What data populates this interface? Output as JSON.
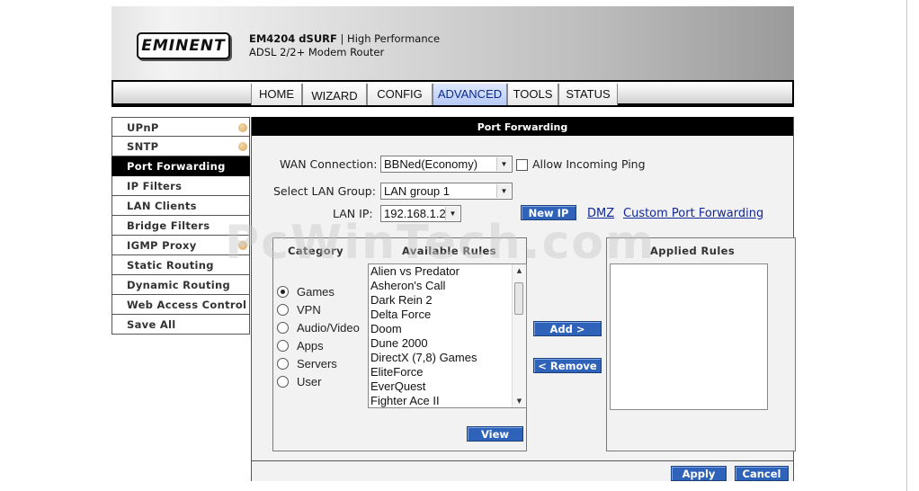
{
  "header": {
    "logo_text": "EMINENT",
    "model": "EM4204 dSURF",
    "tagline": "| High Performance",
    "subtitle": "ADSL 2/2+ Modem Router"
  },
  "tabs": [
    {
      "label": "HOME"
    },
    {
      "label": "WIZARD"
    },
    {
      "label": "CONFIG"
    },
    {
      "label": "ADVANCED",
      "active": true
    },
    {
      "label": "TOOLS"
    },
    {
      "label": "STATUS"
    }
  ],
  "sidebar": {
    "items": [
      {
        "label": "UPnP"
      },
      {
        "label": "SNTP"
      },
      {
        "label": "Port Forwarding"
      },
      {
        "label": "IP Filters"
      },
      {
        "label": "LAN Clients"
      },
      {
        "label": "Bridge Filters"
      },
      {
        "label": "IGMP Proxy"
      },
      {
        "label": "Static Routing"
      },
      {
        "label": "Dynamic Routing"
      },
      {
        "label": "Web Access Control"
      },
      {
        "label": "Save All"
      }
    ]
  },
  "main": {
    "title": "Port Forwarding",
    "wan_label": "WAN Connection:",
    "wan_value": "BBNed(Economy)",
    "ping_label": "Allow Incoming Ping",
    "lan_group_label": "Select LAN Group:",
    "lan_group_value": "LAN group 1",
    "lan_ip_label": "LAN IP:",
    "lan_ip_value": "192.168.1.2",
    "new_ip_button": "New IP",
    "dmz_link": "DMZ",
    "custom_link": "Custom Port Forwarding",
    "category_title": "Category",
    "available_title": "Available Rules",
    "applied_title": "Applied Rules",
    "categories": [
      "Games",
      "VPN",
      "Audio/Video",
      "Apps",
      "Servers",
      "User"
    ],
    "available_rules": [
      "Alien vs Predator",
      "Asheron's Call",
      "Dark Rein 2",
      "Delta Force",
      "Doom",
      "Dune 2000",
      "DirectX (7,8) Games",
      "EliteForce",
      "EverQuest",
      "Fighter Ace II"
    ],
    "add_button": "Add >",
    "remove_button": "< Remove",
    "view_button": "View",
    "apply_button": "Apply",
    "cancel_button": "Cancel"
  },
  "watermark": "PcWinTech.com"
}
